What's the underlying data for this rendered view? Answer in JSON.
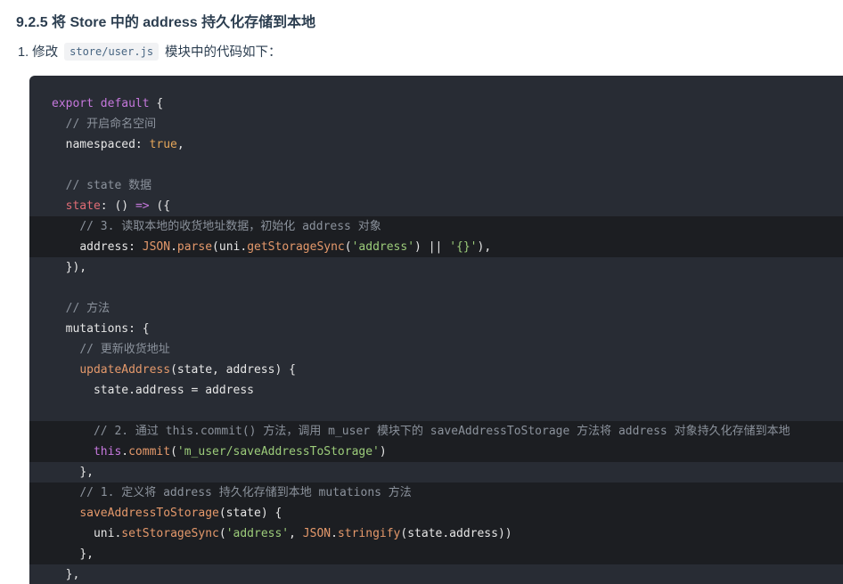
{
  "heading": "9.2.5 将 Store 中的 address 持久化存储到本地",
  "step": {
    "prefix": "1. 修改",
    "file": "store/user.js",
    "suffix": "模块中的代码如下："
  },
  "code": [
    {
      "hl": false,
      "indent": 0,
      "tokens": [
        {
          "t": "kw",
          "v": "export default"
        },
        {
          "t": "pl",
          "v": " {"
        }
      ]
    },
    {
      "hl": false,
      "indent": 2,
      "tokens": [
        {
          "t": "c",
          "v": "// 开启命名空间"
        }
      ]
    },
    {
      "hl": false,
      "indent": 2,
      "tokens": [
        {
          "t": "pl",
          "v": "namespaced: "
        },
        {
          "t": "bo",
          "v": "true"
        },
        {
          "t": "pl",
          "v": ","
        }
      ]
    },
    {
      "hl": false,
      "indent": 0,
      "tokens": []
    },
    {
      "hl": false,
      "indent": 2,
      "tokens": [
        {
          "t": "c",
          "v": "// state 数据"
        }
      ]
    },
    {
      "hl": false,
      "indent": 2,
      "tokens": [
        {
          "t": "pr",
          "v": "state"
        },
        {
          "t": "pl",
          "v": ": () "
        },
        {
          "t": "kw",
          "v": "=>"
        },
        {
          "t": "pl",
          "v": " ({"
        }
      ]
    },
    {
      "hl": true,
      "indent": 4,
      "tokens": [
        {
          "t": "c",
          "v": "// 3. 读取本地的收货地址数据，初始化 address 对象"
        }
      ]
    },
    {
      "hl": true,
      "indent": 4,
      "tokens": [
        {
          "t": "pl",
          "v": "address: "
        },
        {
          "t": "fn",
          "v": "JSON"
        },
        {
          "t": "pl",
          "v": "."
        },
        {
          "t": "fn",
          "v": "parse"
        },
        {
          "t": "pl",
          "v": "(uni."
        },
        {
          "t": "fn",
          "v": "getStorageSync"
        },
        {
          "t": "pl",
          "v": "("
        },
        {
          "t": "st",
          "v": "'address'"
        },
        {
          "t": "pl",
          "v": ") || "
        },
        {
          "t": "st",
          "v": "'{}'"
        },
        {
          "t": "pl",
          "v": "),"
        }
      ]
    },
    {
      "hl": false,
      "indent": 2,
      "tokens": [
        {
          "t": "pl",
          "v": "}),"
        }
      ]
    },
    {
      "hl": false,
      "indent": 0,
      "tokens": []
    },
    {
      "hl": false,
      "indent": 2,
      "tokens": [
        {
          "t": "c",
          "v": "// 方法"
        }
      ]
    },
    {
      "hl": false,
      "indent": 2,
      "tokens": [
        {
          "t": "pl",
          "v": "mutations: {"
        }
      ]
    },
    {
      "hl": false,
      "indent": 4,
      "tokens": [
        {
          "t": "c",
          "v": "// 更新收货地址"
        }
      ]
    },
    {
      "hl": false,
      "indent": 4,
      "tokens": [
        {
          "t": "fn",
          "v": "updateAddress"
        },
        {
          "t": "pl",
          "v": "(state, address) {"
        }
      ]
    },
    {
      "hl": false,
      "indent": 6,
      "tokens": [
        {
          "t": "pl",
          "v": "state.address = address"
        }
      ]
    },
    {
      "hl": false,
      "indent": 0,
      "tokens": []
    },
    {
      "hl": true,
      "indent": 6,
      "tokens": [
        {
          "t": "c",
          "v": "// 2. 通过 this.commit() 方法，调用 m_user 模块下的 saveAddressToStorage 方法将 address 对象持久化存储到本地"
        }
      ]
    },
    {
      "hl": true,
      "indent": 6,
      "tokens": [
        {
          "t": "kw",
          "v": "this"
        },
        {
          "t": "pl",
          "v": "."
        },
        {
          "t": "fn",
          "v": "commit"
        },
        {
          "t": "pl",
          "v": "("
        },
        {
          "t": "st",
          "v": "'m_user/saveAddressToStorage'"
        },
        {
          "t": "pl",
          "v": ")"
        }
      ]
    },
    {
      "hl": false,
      "indent": 4,
      "tokens": [
        {
          "t": "pl",
          "v": "},"
        }
      ]
    },
    {
      "hl": true,
      "indent": 4,
      "tokens": [
        {
          "t": "c",
          "v": "// 1. 定义将 address 持久化存储到本地 mutations 方法"
        }
      ]
    },
    {
      "hl": true,
      "indent": 4,
      "tokens": [
        {
          "t": "fn",
          "v": "saveAddressToStorage"
        },
        {
          "t": "pl",
          "v": "(state) {"
        }
      ]
    },
    {
      "hl": true,
      "indent": 6,
      "tokens": [
        {
          "t": "pl",
          "v": "uni."
        },
        {
          "t": "fn",
          "v": "setStorageSync"
        },
        {
          "t": "pl",
          "v": "("
        },
        {
          "t": "st",
          "v": "'address'"
        },
        {
          "t": "pl",
          "v": ", "
        },
        {
          "t": "fn",
          "v": "JSON"
        },
        {
          "t": "pl",
          "v": "."
        },
        {
          "t": "fn",
          "v": "stringify"
        },
        {
          "t": "pl",
          "v": "(state.address))"
        }
      ]
    },
    {
      "hl": true,
      "indent": 4,
      "tokens": [
        {
          "t": "pl",
          "v": "},"
        }
      ]
    },
    {
      "hl": false,
      "indent": 2,
      "tokens": [
        {
          "t": "pl",
          "v": "},"
        }
      ]
    }
  ]
}
